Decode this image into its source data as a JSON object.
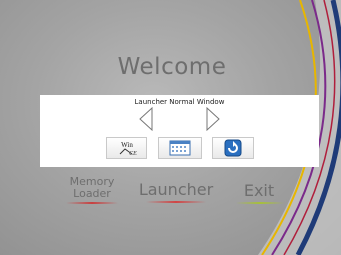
{
  "welcome": {
    "title": "Welcome"
  },
  "panel": {
    "title": "Launcher Normal Window",
    "tiles": [
      {
        "icon": "win-ce-icon",
        "text": "Win",
        "sub": "CE"
      },
      {
        "icon": "grid-icon"
      },
      {
        "icon": "refresh-icon"
      }
    ]
  },
  "menu": {
    "memory_line1": "Memory",
    "memory_line2": "Loader",
    "launcher": "Launcher",
    "exit": "Exit"
  },
  "colors": {
    "background": "#a4a4a4",
    "swoosh": [
      "#1f3b78",
      "#7b2a8a",
      "#e5b400",
      "#d0d0d0"
    ],
    "memory_underline": "#c84040",
    "launcher_underline": "#d04545",
    "exit_underline": "#a7c03a"
  }
}
